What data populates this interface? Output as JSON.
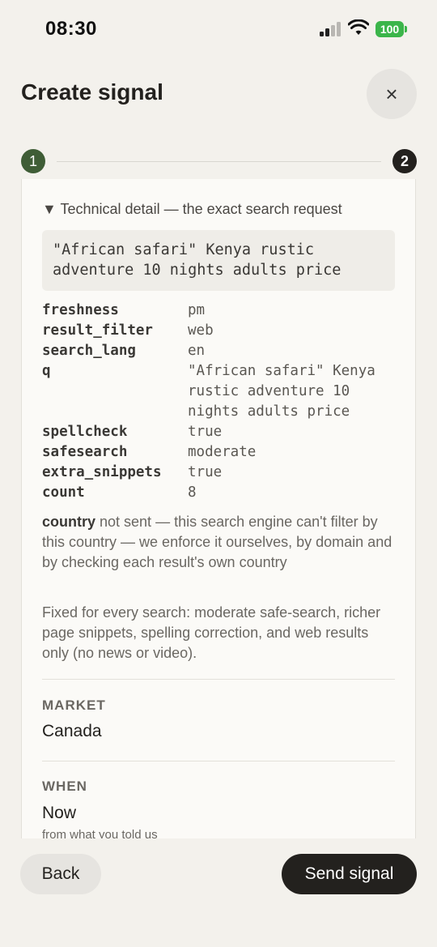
{
  "status_bar": {
    "time": "08:30",
    "battery": "100",
    "signal_icon": "cellular-signal-icon",
    "wifi_icon": "wifi-icon",
    "battery_color": "#3bb54a"
  },
  "header": {
    "title": "Create signal",
    "close_label": "×"
  },
  "stepper": {
    "step1": "1",
    "step2": "2",
    "step1_color": "#3f5d36",
    "step2_color": "#23211e"
  },
  "details": {
    "summary": "▼ Technical detail — the exact search request",
    "query": "\"African safari\" Kenya rustic adventure 10 nights adults price",
    "params": [
      {
        "key": "freshness",
        "value": "pm"
      },
      {
        "key": "result_filter",
        "value": "web"
      },
      {
        "key": "search_lang",
        "value": "en"
      },
      {
        "key": "q",
        "value": "\"African safari\" Kenya rustic adventure 10 nights adults price"
      },
      {
        "key": "spellcheck",
        "value": "true"
      },
      {
        "key": "safesearch",
        "value": "moderate"
      },
      {
        "key": "extra_snippets",
        "value": "true"
      },
      {
        "key": "count",
        "value": "8"
      }
    ],
    "country_bold": "country",
    "country_note": " not sent — this search engine can't filter by this country — we enforce it ourselves, by domain and by checking each result's own country",
    "fixed_note": "Fixed for every search: moderate safe-search, richer page snippets, spelling correction, and web results only (no news or video)."
  },
  "market": {
    "label": "MARKET",
    "value": "Canada"
  },
  "when": {
    "label": "WHEN",
    "value": "Now",
    "sub": "from what you told us"
  },
  "footer": {
    "back_label": "Back",
    "send_label": "Send signal"
  }
}
